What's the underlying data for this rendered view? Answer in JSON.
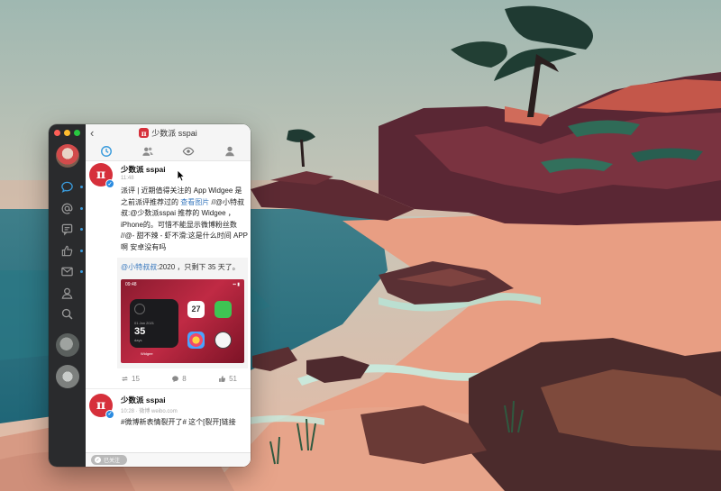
{
  "window": {
    "title": "少数派 sspai",
    "logo_glyph": "π",
    "back_glyph": "‹"
  },
  "sidebar": {
    "items": [
      {
        "icon": "chat-bubble-icon",
        "active": true,
        "badge": true
      },
      {
        "icon": "at-mention-icon",
        "badge": true
      },
      {
        "icon": "comment-icon",
        "badge": true
      },
      {
        "icon": "thumbs-up-icon",
        "badge": true
      },
      {
        "icon": "mail-icon",
        "badge": true
      },
      {
        "icon": "person-icon"
      },
      {
        "icon": "search-icon"
      }
    ]
  },
  "tabs": [
    {
      "icon": "clock-icon",
      "active": true
    },
    {
      "icon": "people-icon"
    },
    {
      "icon": "eye-icon"
    },
    {
      "icon": "person-icon"
    }
  ],
  "posts": [
    {
      "author": "少数派 sspai",
      "time": "11:48",
      "text_prefix": "派评 | 近期值得关注的 App Widgee 是之前派评推荐过的",
      "text_image_link": "查看图片",
      "text_suffix": " //@小特叔叔:@少数派sspai 推荐的 Widgee ，iPhone的。可惜不能显示微博粉丝数  //@- 甜不辣 - 虾不滑:这是什么时间 APP 啊 安卓没有吗",
      "repost_mention": "@小特叔叔",
      "repost_text": ":2020 ，只剩下 35 天了。",
      "shot": {
        "time": "09:48",
        "date": "01 Jan 2021",
        "days_num": "35",
        "days_label": "days",
        "calendar_day": "27",
        "widget_name": "Widgee"
      },
      "reposts": "15",
      "comments": "8",
      "likes": "51"
    },
    {
      "author": "少数派 sspai",
      "time": "10:28 · 微博 weibo.com",
      "text": "#微博新表情裂开了# 这个[裂开]链接"
    }
  ],
  "follow_label": "已关注",
  "colors": {
    "accent": "#3a9bdc",
    "brand": "#d6303b",
    "sidebar": "#2a2b2d"
  }
}
